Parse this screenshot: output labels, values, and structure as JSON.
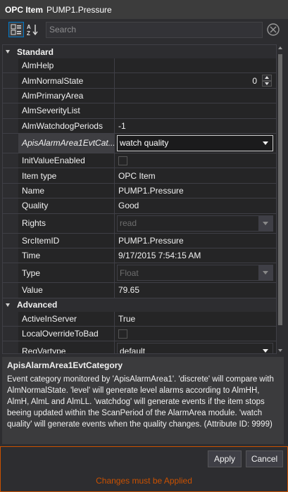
{
  "title": {
    "label": "OPC Item",
    "item": "PUMP1.Pressure"
  },
  "toolbar": {
    "categorized_icon": "categorized-icon",
    "sort_icon": "sort-alphabetical-icon",
    "search_placeholder": "Search",
    "clear_icon": "clear-search-icon"
  },
  "grid": {
    "category_standard": "Standard",
    "category_advanced": "Advanced",
    "standard": [
      {
        "name": "AlmHelp",
        "value": ""
      },
      {
        "name": "AlmNormalState",
        "value": "0"
      },
      {
        "name": "AlmPrimaryArea",
        "value": ""
      },
      {
        "name": "AlmSeverityList",
        "value": ""
      },
      {
        "name": "AlmWatchdogPeriods",
        "value": "-1"
      },
      {
        "name": "ApisAlarmArea1EvtCat...",
        "value": "watch quality"
      },
      {
        "name": "InitValueEnabled",
        "value": ""
      },
      {
        "name": "Item type",
        "value": "OPC Item"
      },
      {
        "name": "Name",
        "value": "PUMP1.Pressure"
      },
      {
        "name": "Quality",
        "value": "Good"
      },
      {
        "name": "Rights",
        "value": "read"
      },
      {
        "name": "SrcItemID",
        "value": "PUMP1.Pressure"
      },
      {
        "name": "Time",
        "value": "9/17/2015 7:54:15 AM"
      },
      {
        "name": "Type",
        "value": "Float"
      },
      {
        "name": "Value",
        "value": "79.65"
      }
    ],
    "advanced": [
      {
        "name": "ActiveInServer",
        "value": "True"
      },
      {
        "name": "LocalOverrideToBad",
        "value": ""
      },
      {
        "name": "ReqVartype",
        "value": "default"
      }
    ]
  },
  "description": {
    "title": "ApisAlarmArea1EvtCategory",
    "text": "Event category monitored by 'ApisAlarmArea1'. 'discrete' will compare with AlmNormalState. 'level' will generate level alarms according to AlmHH, AlmH, AlmL and AlmLL. 'watchdog' will generate events if the item stops beeing updated within the ScanPeriod of the AlarmArea module. 'watch quality' will generate events when the quality changes. (Attribute ID: 9999)"
  },
  "footer": {
    "apply": "Apply",
    "cancel": "Cancel",
    "note": "Changes must be Applied"
  },
  "colors": {
    "accent": "#007acc",
    "warning": "#ca5100"
  }
}
